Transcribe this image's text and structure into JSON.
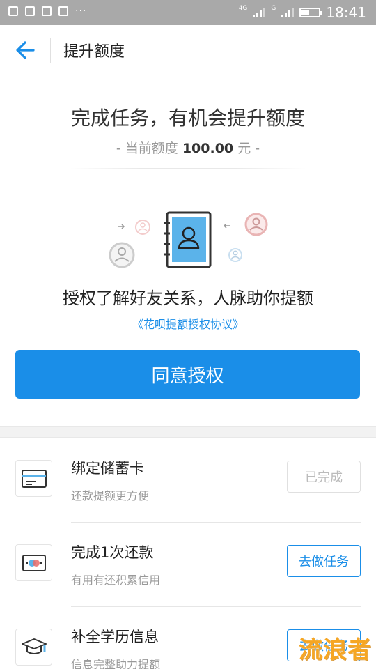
{
  "status_bar": {
    "network_1": "4G",
    "network_2": "G",
    "time": "18:41"
  },
  "header": {
    "title": "提升额度",
    "back_icon": "arrow-left-icon"
  },
  "hero": {
    "title": "完成任务，有机会提升额度",
    "quota_prefix": "- 当前额度 ",
    "quota_value": "100.00",
    "quota_suffix": " 元 -"
  },
  "authorization": {
    "title": "授权了解好友关系，人脉助你提额",
    "agreement_link": "《花呗提额授权协议》",
    "button_label": "同意授权"
  },
  "tasks": [
    {
      "icon": "bank-card-icon",
      "title": "绑定储蓄卡",
      "desc": "还款提额更方便",
      "button": "已完成",
      "status": "done"
    },
    {
      "icon": "repayment-card-icon",
      "title": "完成1次还款",
      "desc": "有用有还积累信用",
      "button": "去做任务",
      "status": "todo"
    },
    {
      "icon": "graduation-cap-icon",
      "title": "补全学历信息",
      "desc": "信息完整助力提额",
      "button": "去做任务",
      "status": "todo"
    }
  ],
  "colors": {
    "accent": "#1a8ee8",
    "status_bar": "#a9a9a9",
    "watermark": "#f6a623"
  },
  "watermark": "流浪者"
}
